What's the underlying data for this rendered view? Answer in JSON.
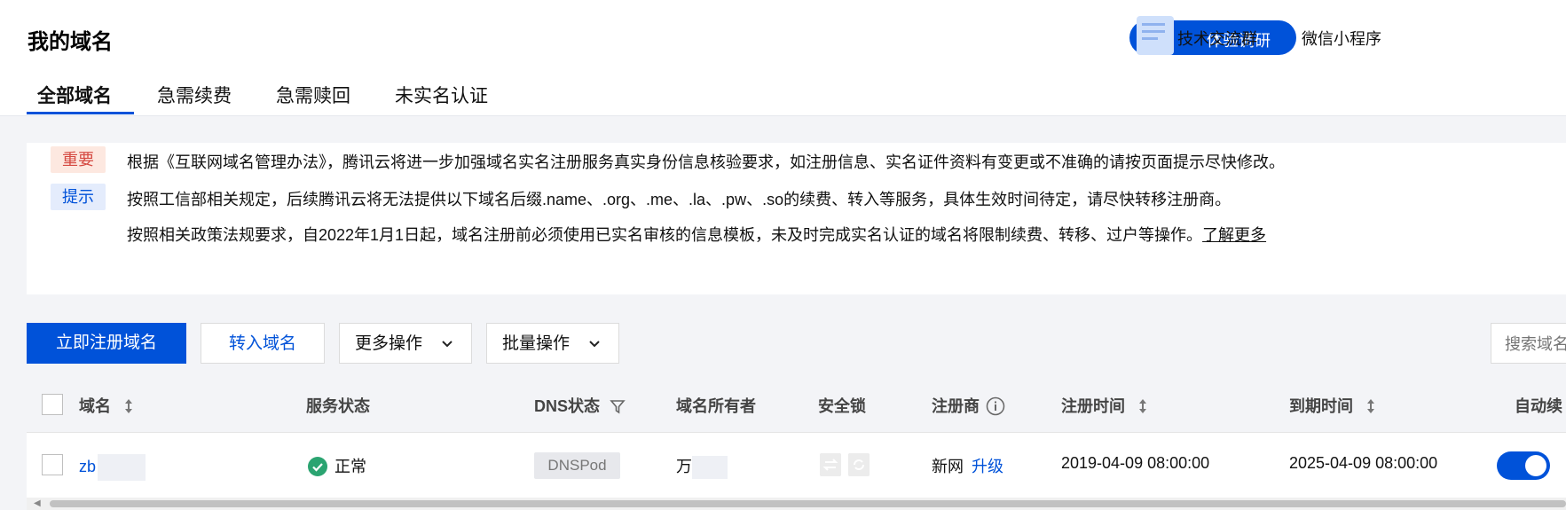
{
  "header": {
    "title": "我的域名",
    "survey_label": "体验调研",
    "links": [
      "技术交流群",
      "微信小程序"
    ],
    "tabs": [
      "全部域名",
      "急需续费",
      "急需赎回",
      "未实名认证"
    ],
    "active_tab": "全部域名"
  },
  "notice": {
    "important_badge": "重要",
    "tip_badge": "提示",
    "line1": "根据《互联网域名管理办法》，腾讯云将进一步加强域名实名注册服务真实身份信息核验要求，如注册信息、实名证件资料有变更或不准确的请按页面提示尽快修改。",
    "line2": "按照工信部相关规定，后续腾讯云将无法提供以下域名后缀.name、.org、.me、.la、.pw、.so的续费、转入等服务，具体生效时间待定，请尽快转移注册商。",
    "line3": "按照相关政策法规要求，自2022年1月1日起，域名注册前必须使用已实名审核的信息模板，未及时完成实名认证的域名将限制续费、转移、过户等操作。",
    "learn_more": "了解更多"
  },
  "toolbar": {
    "register_label": "立即注册域名",
    "transfer_label": "转入域名",
    "more_actions_label": "更多操作",
    "batch_actions_label": "批量操作",
    "search_placeholder": "搜索域名"
  },
  "table": {
    "columns": {
      "domain": "域名",
      "service_status": "服务状态",
      "dns_status": "DNS状态",
      "owner": "域名所有者",
      "security_lock": "安全锁",
      "registrar": "注册商",
      "register_time": "注册时间",
      "expire_time": "到期时间",
      "auto_renew": "自动续"
    },
    "rows": [
      {
        "domain": "zb",
        "service_status": "正常",
        "dns": "DNSPod",
        "owner": "万",
        "registrar": "新网",
        "upgrade": "升级",
        "register_time": "2019-04-09 08:00:00",
        "expire_time": "2025-04-09 08:00:00",
        "auto_renew": true
      }
    ]
  },
  "colors": {
    "primary": "#0052d9",
    "success": "#2ba471",
    "important": "#d54941"
  }
}
